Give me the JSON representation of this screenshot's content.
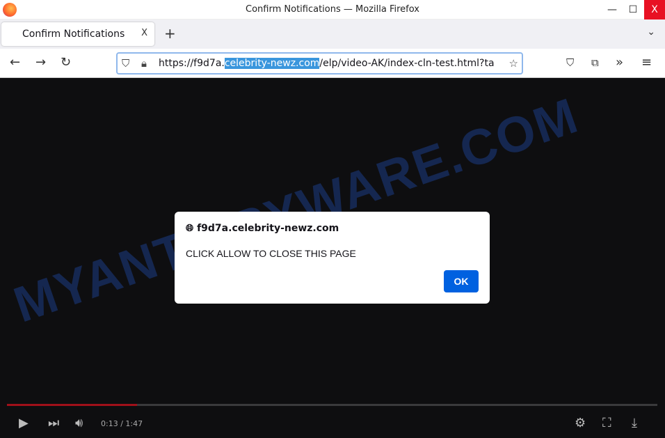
{
  "window": {
    "title": "Confirm Notifications — Mozilla Firefox",
    "minimize": "—",
    "maximize": "☐",
    "close": "X"
  },
  "tab": {
    "label": "Confirm Notifications",
    "close": "X",
    "new_tab": "+",
    "list": "⌄"
  },
  "nav": {
    "url_prefix": "https://f9d7a.",
    "url_domain": "celebrity-newz.com",
    "url_suffix": "/elp/video-AK/index-cln-test.html?ta"
  },
  "watermark": "MYANTISPYWARE.COM",
  "dialog": {
    "host": "f9d7a.celebrity-newz.com",
    "message": "CLICK ALLOW TO CLOSE THIS PAGE",
    "ok": "OK"
  },
  "player": {
    "time": "0:13 / 1:47",
    "progress_fraction": 0.2,
    "progress_color": "#a0101a"
  },
  "colors": {
    "accent": "#0061e0",
    "url_highlight": "#3a96dd",
    "close_button": "#e81123"
  }
}
